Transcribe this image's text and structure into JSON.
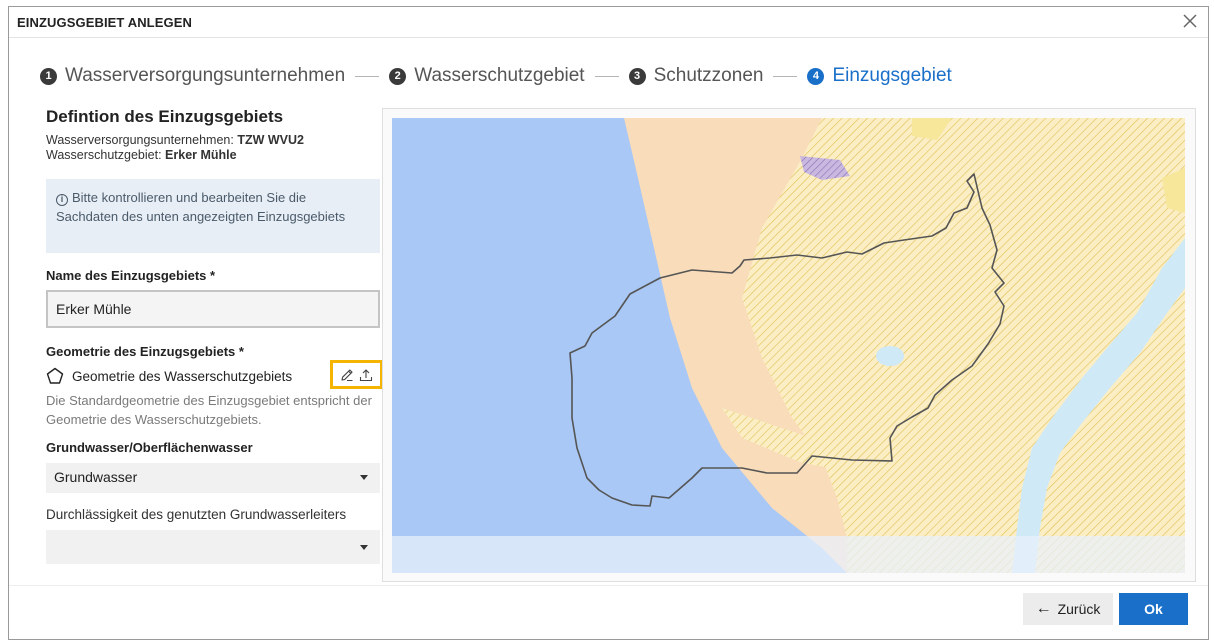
{
  "dialog": {
    "title": "EINZUGSGEBIET ANLEGEN",
    "close_icon": "close-icon"
  },
  "stepper": {
    "steps": [
      {
        "number": "1",
        "label": "Wasserversorgungsunternehmen",
        "active": false
      },
      {
        "number": "2",
        "label": "Wasserschutzgebiet",
        "active": false
      },
      {
        "number": "3",
        "label": "Schutzzonen",
        "active": false
      },
      {
        "number": "4",
        "label": "Einzugsgebiet",
        "active": true
      }
    ],
    "active_color": "#1a6fc9"
  },
  "form": {
    "section_title": "Defintion des Einzugsgebiets",
    "wvu_label": "Wasserversorgungsunternehmen:",
    "wvu_value": "TZW WVU2",
    "wsg_label": "Wasserschutzgebiet:",
    "wsg_value": "Erker Mühle",
    "notice_icon": "info-icon",
    "notice_text": "Bitte kontrollieren und bearbeiten Sie die Sachdaten des unten angezeigten Einzugsgebiets",
    "name_label": "Name des Einzugsgebiets *",
    "name_value": "Erker Mühle",
    "geometry_label": "Geometrie des Einzugsgebiets *",
    "geometry_icon": "polygon-icon",
    "geometry_value": "Geometrie des Wasserschutzgebiets",
    "edit_icon": "pencil-icon",
    "upload_icon": "upload-icon",
    "geometry_help": "Die Standardgeometrie des Einzugsgebiet entspricht der Geometrie des Wasserschutzgebiets.",
    "water_type_label": "Grundwasser/Oberflächenwasser",
    "water_type_value": "Grundwasser",
    "permeability_label": "Durchlässigkeit des genutzten Grundwasserleiters",
    "permeability_value": ""
  },
  "map": {
    "colors": {
      "water": "#a9c8f5",
      "land": "#f9dcba",
      "hatch_area": "#fbeec4",
      "hatch_line": "#e0c25a",
      "river": "#cfe9f7",
      "outline": "#555555",
      "purple_hatch": "#a08ac0"
    }
  },
  "footer": {
    "back_label": "Zurück",
    "back_icon": "arrow-left-icon",
    "ok_label": "Ok"
  },
  "accent": "#1a6fc9",
  "highlight": "#f4b400"
}
